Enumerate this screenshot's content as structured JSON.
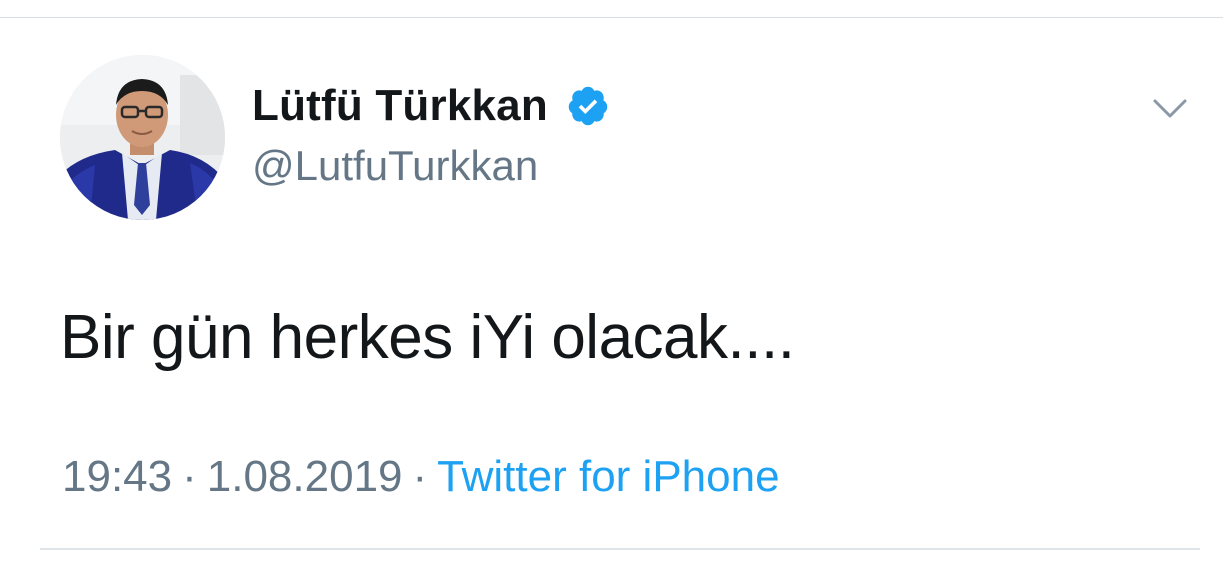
{
  "author": {
    "display_name": "Lütfü Türkkan",
    "handle": "@LutfuTurkkan",
    "verified": true
  },
  "tweet": {
    "text": "Bir gün herkes iYi olacak...."
  },
  "meta": {
    "time": "19:43",
    "separator": "·",
    "date": "1.08.2019",
    "source": "Twitter for iPhone"
  },
  "icons": {
    "verified": "verified-badge-icon",
    "menu": "chevron-down-icon"
  },
  "colors": {
    "text": "#14171a",
    "secondary": "#657786",
    "link": "#1da1f2",
    "verified": "#1da1f2"
  }
}
